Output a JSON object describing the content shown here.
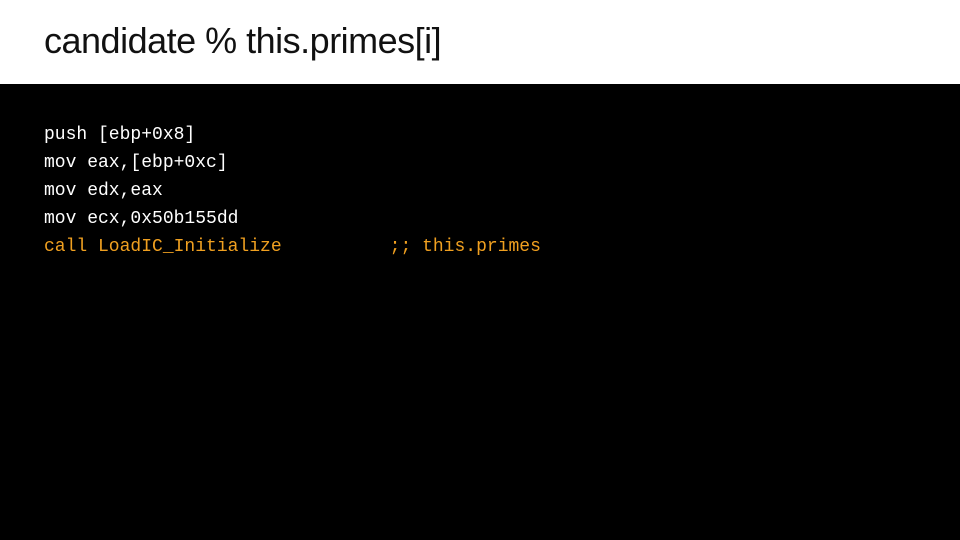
{
  "header": {
    "title": "candidate % this.primes[i]"
  },
  "code": {
    "lines": [
      {
        "text": "push [ebp+0x8]",
        "highlight": false,
        "comment": ""
      },
      {
        "text": "mov eax,[ebp+0xc]",
        "highlight": false,
        "comment": ""
      },
      {
        "text": "mov edx,eax",
        "highlight": false,
        "comment": ""
      },
      {
        "text": "mov ecx,0x50b155dd",
        "highlight": false,
        "comment": ""
      },
      {
        "text": "call LoadIC_Initialize",
        "highlight": true,
        "comment": ";; this.primes"
      }
    ]
  }
}
